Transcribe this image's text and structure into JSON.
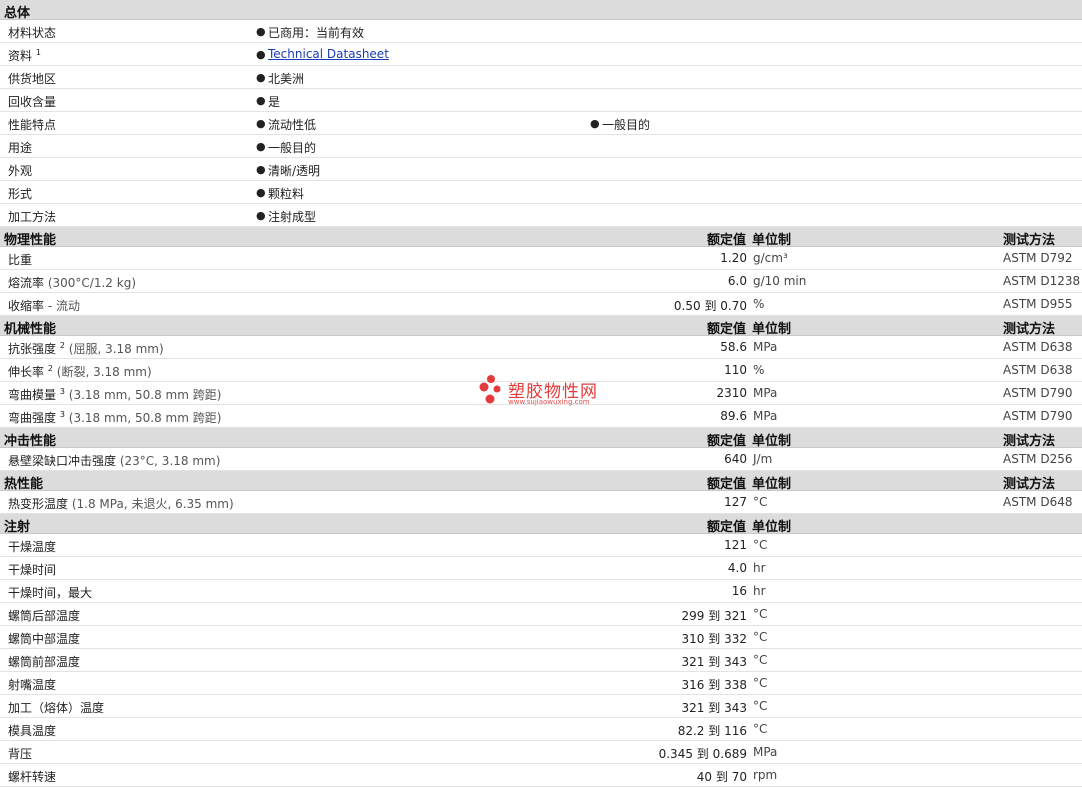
{
  "general": {
    "title": "总体",
    "rows": [
      {
        "label": "材料状态",
        "items": [
          "已商用：当前有效"
        ]
      },
      {
        "label": "资料",
        "sup": "1",
        "link": "Technical Datasheet"
      },
      {
        "label": "供货地区",
        "items": [
          "北美洲"
        ]
      },
      {
        "label": "回收含量",
        "items": [
          "是"
        ]
      },
      {
        "label": "性能特点",
        "items": [
          "流动性低",
          "一般目的"
        ]
      },
      {
        "label": "用途",
        "items": [
          "一般目的"
        ]
      },
      {
        "label": "外观",
        "items": [
          "清晰/透明"
        ]
      },
      {
        "label": "形式",
        "items": [
          "颗粒料"
        ]
      },
      {
        "label": "加工方法",
        "items": [
          "注射成型"
        ]
      }
    ]
  },
  "col_headers": {
    "nominal": "额定值",
    "unit": "单位制",
    "test": "测试方法"
  },
  "bullet_char": "●",
  "range_word": "到",
  "sections": [
    {
      "title": "物理性能",
      "has_test": true,
      "rows": [
        {
          "label": "比重",
          "value": "1.20",
          "unit": "g/cm³",
          "test": "ASTM D792"
        },
        {
          "label": "熔流率",
          "cond": "(300°C/1.2 kg)",
          "value": "6.0",
          "unit": "g/10 min",
          "test": "ASTM D1238"
        },
        {
          "label": "收缩率",
          "cond": "- 流动",
          "lo": "0.50",
          "hi": "0.70",
          "unit": "%",
          "test": "ASTM D955"
        }
      ]
    },
    {
      "title": "机械性能",
      "has_test": true,
      "rows": [
        {
          "label": "抗张强度",
          "sup": "2",
          "cond": "(屈服, 3.18 mm)",
          "value": "58.6",
          "unit": "MPa",
          "test": "ASTM D638"
        },
        {
          "label": "伸长率",
          "sup": "2",
          "cond": "(断裂, 3.18 mm)",
          "value": "110",
          "unit": "%",
          "test": "ASTM D638"
        },
        {
          "label": "弯曲模量",
          "sup": "3",
          "cond": "(3.18 mm, 50.8 mm 跨距)",
          "value": "2310",
          "unit": "MPa",
          "test": "ASTM D790"
        },
        {
          "label": "弯曲强度",
          "sup": "3",
          "cond": "(3.18 mm, 50.8 mm 跨距)",
          "value": "89.6",
          "unit": "MPa",
          "test": "ASTM D790"
        }
      ]
    },
    {
      "title": "冲击性能",
      "has_test": true,
      "rows": [
        {
          "label": "悬壁梁缺口冲击强度",
          "cond": "(23°C, 3.18 mm)",
          "value": "640",
          "unit": "J/m",
          "test": "ASTM D256"
        }
      ]
    },
    {
      "title": "热性能",
      "has_test": true,
      "rows": [
        {
          "label": "热变形温度",
          "cond": "(1.8 MPa, 未退火, 6.35 mm)",
          "value": "127",
          "unit": "°C",
          "test": "ASTM D648"
        }
      ]
    },
    {
      "title": "注射",
      "has_test": false,
      "rows": [
        {
          "label": "干燥温度",
          "value": "121",
          "unit": "°C"
        },
        {
          "label": "干燥时间",
          "value": "4.0",
          "unit": "hr"
        },
        {
          "label": "干燥时间，最大",
          "value": "16",
          "unit": "hr"
        },
        {
          "label": "螺筒后部温度",
          "lo": "299",
          "hi": "321",
          "unit": "°C"
        },
        {
          "label": "螺筒中部温度",
          "lo": "310",
          "hi": "332",
          "unit": "°C"
        },
        {
          "label": "螺筒前部温度",
          "lo": "321",
          "hi": "343",
          "unit": "°C"
        },
        {
          "label": "射嘴温度",
          "lo": "316",
          "hi": "338",
          "unit": "°C"
        },
        {
          "label": "加工（熔体）温度",
          "lo": "321",
          "hi": "343",
          "unit": "°C"
        },
        {
          "label": "模具温度",
          "lo": "82.2",
          "hi": "116",
          "unit": "°C"
        },
        {
          "label": "背压",
          "lo": "0.345",
          "hi": "0.689",
          "unit": "MPa"
        },
        {
          "label": "螺杆转速",
          "lo": "40",
          "hi": "70",
          "unit": "rpm"
        }
      ]
    }
  ],
  "watermark": {
    "text": "塑胶物性网",
    "url": "www.sujiaowuxing.com",
    "color": "#e33b3b"
  }
}
